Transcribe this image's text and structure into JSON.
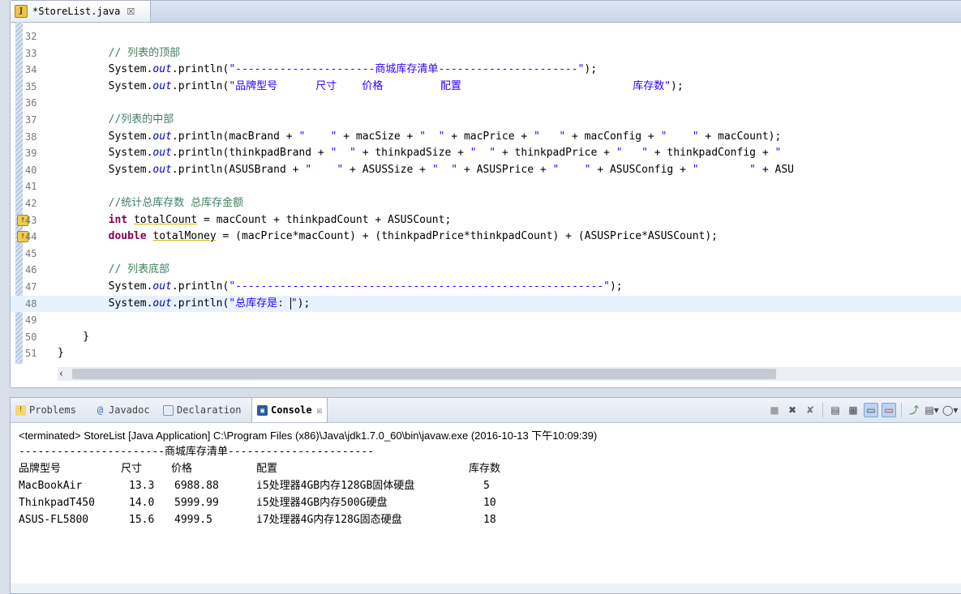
{
  "editor": {
    "tab_label": "*StoreList.java",
    "tab_close": "☒",
    "lines": [
      {
        "n": "32",
        "segs": []
      },
      {
        "n": "33",
        "segs": [
          {
            "t": "        "
          },
          {
            "t": "// 列表的顶部",
            "c": "cm"
          }
        ]
      },
      {
        "n": "34",
        "segs": [
          {
            "t": "        System."
          },
          {
            "t": "out",
            "c": "fld"
          },
          {
            "t": ".println("
          },
          {
            "t": "\"----------------------商城库存清单----------------------\"",
            "c": "str"
          },
          {
            "t": ");"
          }
        ]
      },
      {
        "n": "35",
        "segs": [
          {
            "t": "        System."
          },
          {
            "t": "out",
            "c": "fld"
          },
          {
            "t": ".println("
          },
          {
            "t": "\"品牌型号      尺寸    价格         配置                           库存数\"",
            "c": "str"
          },
          {
            "t": ");"
          }
        ]
      },
      {
        "n": "36",
        "segs": []
      },
      {
        "n": "37",
        "segs": [
          {
            "t": "        "
          },
          {
            "t": "//列表的中部",
            "c": "cm"
          }
        ]
      },
      {
        "n": "38",
        "segs": [
          {
            "t": "        System."
          },
          {
            "t": "out",
            "c": "fld"
          },
          {
            "t": ".println(macBrand + "
          },
          {
            "t": "\"    \"",
            "c": "str"
          },
          {
            "t": " + macSize + "
          },
          {
            "t": "\"  \"",
            "c": "str"
          },
          {
            "t": " + macPrice + "
          },
          {
            "t": "\"   \"",
            "c": "str"
          },
          {
            "t": " + macConfig + "
          },
          {
            "t": "\"    \"",
            "c": "str"
          },
          {
            "t": " + macCount);"
          }
        ]
      },
      {
        "n": "39",
        "segs": [
          {
            "t": "        System."
          },
          {
            "t": "out",
            "c": "fld"
          },
          {
            "t": ".println(thinkpadBrand + "
          },
          {
            "t": "\"  \"",
            "c": "str"
          },
          {
            "t": " + thinkpadSize + "
          },
          {
            "t": "\"  \"",
            "c": "str"
          },
          {
            "t": " + thinkpadPrice + "
          },
          {
            "t": "\"   \"",
            "c": "str"
          },
          {
            "t": " + thinkpadConfig + "
          },
          {
            "t": "\"",
            "c": "str"
          }
        ]
      },
      {
        "n": "40",
        "segs": [
          {
            "t": "        System."
          },
          {
            "t": "out",
            "c": "fld"
          },
          {
            "t": ".println(ASUSBrand + "
          },
          {
            "t": "\"    \"",
            "c": "str"
          },
          {
            "t": " + ASUSSize + "
          },
          {
            "t": "\"  \"",
            "c": "str"
          },
          {
            "t": " + ASUSPrice + "
          },
          {
            "t": "\"    \"",
            "c": "str"
          },
          {
            "t": " + ASUSConfig + "
          },
          {
            "t": "\"        \"",
            "c": "str"
          },
          {
            "t": " + ASU"
          }
        ]
      },
      {
        "n": "41",
        "segs": []
      },
      {
        "n": "42",
        "segs": [
          {
            "t": "        "
          },
          {
            "t": "//统计总库存数 总库存金额",
            "c": "cm"
          }
        ]
      },
      {
        "n": "43",
        "warn": true,
        "segs": [
          {
            "t": "        "
          },
          {
            "t": "int",
            "c": "kw"
          },
          {
            "t": " "
          },
          {
            "t": "totalCount",
            "c": "underline"
          },
          {
            "t": " = macCount + thinkpadCount + ASUSCount;"
          }
        ]
      },
      {
        "n": "44",
        "warn": true,
        "segs": [
          {
            "t": "        "
          },
          {
            "t": "double",
            "c": "kw"
          },
          {
            "t": " "
          },
          {
            "t": "totalMoney",
            "c": "underline"
          },
          {
            "t": " = (macPrice*macCount) + (thinkpadPrice*thinkpadCount) + (ASUSPrice*ASUSCount);"
          }
        ]
      },
      {
        "n": "45",
        "segs": []
      },
      {
        "n": "46",
        "segs": [
          {
            "t": "        "
          },
          {
            "t": "// 列表底部",
            "c": "cm"
          }
        ]
      },
      {
        "n": "47",
        "segs": [
          {
            "t": "        System."
          },
          {
            "t": "out",
            "c": "fld"
          },
          {
            "t": ".println("
          },
          {
            "t": "\"----------------------------------------------------------\"",
            "c": "str"
          },
          {
            "t": ");"
          }
        ]
      },
      {
        "n": "48",
        "current": true,
        "segs": [
          {
            "t": "        System."
          },
          {
            "t": "out",
            "c": "fld"
          },
          {
            "t": ".println("
          },
          {
            "t": "\"总库存是: \"",
            "c": "str",
            "caret": true
          },
          {
            "t": ");"
          }
        ]
      },
      {
        "n": "49",
        "segs": []
      },
      {
        "n": "50",
        "segs": [
          {
            "t": "    }"
          }
        ]
      },
      {
        "n": "51",
        "segs": [
          {
            "t": "}"
          }
        ]
      }
    ]
  },
  "panel": {
    "tabs": [
      {
        "label": "Problems",
        "icon": "problems-icon",
        "active": false
      },
      {
        "label": "Javadoc",
        "icon": "javadoc-icon",
        "active": false
      },
      {
        "label": "Declaration",
        "icon": "declaration-icon",
        "active": false
      },
      {
        "label": "Console",
        "icon": "console-icon",
        "active": true,
        "close": "☒"
      }
    ],
    "status": "<terminated> StoreList [Java Application] C:\\Program Files (x86)\\Java\\jdk1.7.0_60\\bin\\javaw.exe (2016-10-13 下午10:09:39)",
    "output": {
      "header_line": "-----------------------商城库存清单-----------------------",
      "columns": [
        "品牌型号",
        "尺寸",
        "价格",
        "配置",
        "库存数"
      ],
      "rows": [
        [
          "MacBookAir",
          "13.3",
          "6988.88",
          "i5处理器4GB内存128GB固体硬盘",
          "5"
        ],
        [
          "ThinkpadT450",
          "14.0",
          "5999.99",
          "i5处理器4GB内存500G硬盘",
          "10"
        ],
        [
          "ASUS-FL5800",
          "15.6",
          "4999.5",
          "i7处理器4G内存128G固态硬盘",
          "18"
        ]
      ]
    }
  },
  "icons": {
    "toolbar": [
      "terminate-icon",
      "remove-launch-icon",
      "remove-all-icon",
      "clear-console-icon",
      "scroll-lock-icon",
      "word-wrap-icon",
      "show-on-output-icon",
      "pin-console-icon",
      "display-console-icon",
      "open-console-icon"
    ]
  }
}
